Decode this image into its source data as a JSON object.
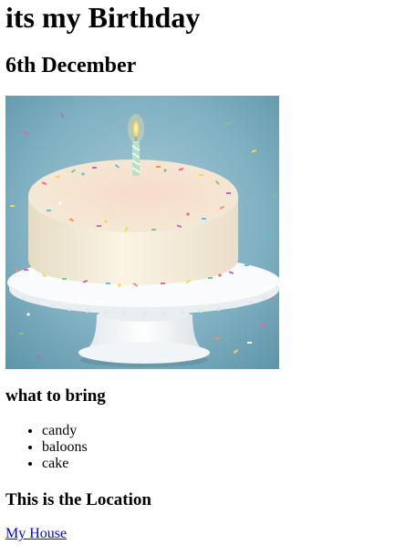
{
  "page": {
    "title": "its my Birthday",
    "date": "6th December"
  },
  "image": {
    "icon": "birthday-cake-icon",
    "colors": {
      "background": "#7fb0c2",
      "frosting": "#f4ead6",
      "stand": "#f5f5f5",
      "flame": "#ffd966"
    }
  },
  "bring": {
    "heading": "what to bring",
    "items": [
      "candy",
      "baloons",
      "cake"
    ]
  },
  "location": {
    "heading": "This is the Location",
    "link_text": "My House"
  },
  "colors": {
    "link": "#0000ee",
    "text": "#000000"
  }
}
